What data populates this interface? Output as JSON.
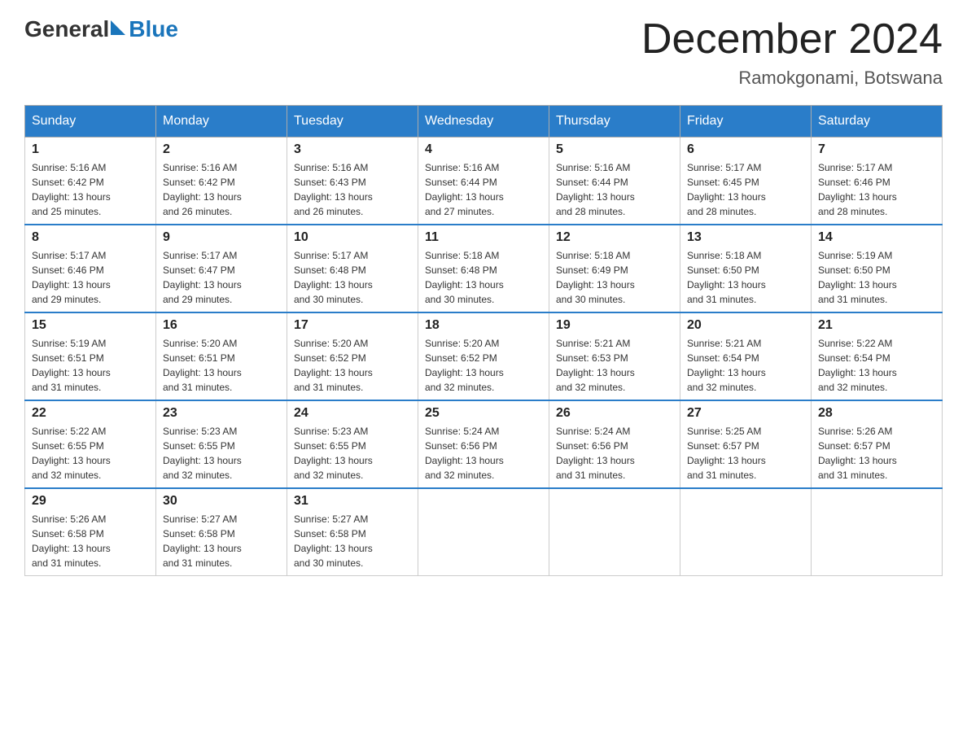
{
  "logo": {
    "general": "General",
    "blue": "Blue"
  },
  "title": {
    "month_year": "December 2024",
    "location": "Ramokgonami, Botswana"
  },
  "headers": [
    "Sunday",
    "Monday",
    "Tuesday",
    "Wednesday",
    "Thursday",
    "Friday",
    "Saturday"
  ],
  "weeks": [
    [
      {
        "day": "1",
        "sunrise": "5:16 AM",
        "sunset": "6:42 PM",
        "daylight": "13 hours and 25 minutes."
      },
      {
        "day": "2",
        "sunrise": "5:16 AM",
        "sunset": "6:42 PM",
        "daylight": "13 hours and 26 minutes."
      },
      {
        "day": "3",
        "sunrise": "5:16 AM",
        "sunset": "6:43 PM",
        "daylight": "13 hours and 26 minutes."
      },
      {
        "day": "4",
        "sunrise": "5:16 AM",
        "sunset": "6:44 PM",
        "daylight": "13 hours and 27 minutes."
      },
      {
        "day": "5",
        "sunrise": "5:16 AM",
        "sunset": "6:44 PM",
        "daylight": "13 hours and 28 minutes."
      },
      {
        "day": "6",
        "sunrise": "5:17 AM",
        "sunset": "6:45 PM",
        "daylight": "13 hours and 28 minutes."
      },
      {
        "day": "7",
        "sunrise": "5:17 AM",
        "sunset": "6:46 PM",
        "daylight": "13 hours and 28 minutes."
      }
    ],
    [
      {
        "day": "8",
        "sunrise": "5:17 AM",
        "sunset": "6:46 PM",
        "daylight": "13 hours and 29 minutes."
      },
      {
        "day": "9",
        "sunrise": "5:17 AM",
        "sunset": "6:47 PM",
        "daylight": "13 hours and 29 minutes."
      },
      {
        "day": "10",
        "sunrise": "5:17 AM",
        "sunset": "6:48 PM",
        "daylight": "13 hours and 30 minutes."
      },
      {
        "day": "11",
        "sunrise": "5:18 AM",
        "sunset": "6:48 PM",
        "daylight": "13 hours and 30 minutes."
      },
      {
        "day": "12",
        "sunrise": "5:18 AM",
        "sunset": "6:49 PM",
        "daylight": "13 hours and 30 minutes."
      },
      {
        "day": "13",
        "sunrise": "5:18 AM",
        "sunset": "6:50 PM",
        "daylight": "13 hours and 31 minutes."
      },
      {
        "day": "14",
        "sunrise": "5:19 AM",
        "sunset": "6:50 PM",
        "daylight": "13 hours and 31 minutes."
      }
    ],
    [
      {
        "day": "15",
        "sunrise": "5:19 AM",
        "sunset": "6:51 PM",
        "daylight": "13 hours and 31 minutes."
      },
      {
        "day": "16",
        "sunrise": "5:20 AM",
        "sunset": "6:51 PM",
        "daylight": "13 hours and 31 minutes."
      },
      {
        "day": "17",
        "sunrise": "5:20 AM",
        "sunset": "6:52 PM",
        "daylight": "13 hours and 31 minutes."
      },
      {
        "day": "18",
        "sunrise": "5:20 AM",
        "sunset": "6:52 PM",
        "daylight": "13 hours and 32 minutes."
      },
      {
        "day": "19",
        "sunrise": "5:21 AM",
        "sunset": "6:53 PM",
        "daylight": "13 hours and 32 minutes."
      },
      {
        "day": "20",
        "sunrise": "5:21 AM",
        "sunset": "6:54 PM",
        "daylight": "13 hours and 32 minutes."
      },
      {
        "day": "21",
        "sunrise": "5:22 AM",
        "sunset": "6:54 PM",
        "daylight": "13 hours and 32 minutes."
      }
    ],
    [
      {
        "day": "22",
        "sunrise": "5:22 AM",
        "sunset": "6:55 PM",
        "daylight": "13 hours and 32 minutes."
      },
      {
        "day": "23",
        "sunrise": "5:23 AM",
        "sunset": "6:55 PM",
        "daylight": "13 hours and 32 minutes."
      },
      {
        "day": "24",
        "sunrise": "5:23 AM",
        "sunset": "6:55 PM",
        "daylight": "13 hours and 32 minutes."
      },
      {
        "day": "25",
        "sunrise": "5:24 AM",
        "sunset": "6:56 PM",
        "daylight": "13 hours and 32 minutes."
      },
      {
        "day": "26",
        "sunrise": "5:24 AM",
        "sunset": "6:56 PM",
        "daylight": "13 hours and 31 minutes."
      },
      {
        "day": "27",
        "sunrise": "5:25 AM",
        "sunset": "6:57 PM",
        "daylight": "13 hours and 31 minutes."
      },
      {
        "day": "28",
        "sunrise": "5:26 AM",
        "sunset": "6:57 PM",
        "daylight": "13 hours and 31 minutes."
      }
    ],
    [
      {
        "day": "29",
        "sunrise": "5:26 AM",
        "sunset": "6:58 PM",
        "daylight": "13 hours and 31 minutes."
      },
      {
        "day": "30",
        "sunrise": "5:27 AM",
        "sunset": "6:58 PM",
        "daylight": "13 hours and 31 minutes."
      },
      {
        "day": "31",
        "sunrise": "5:27 AM",
        "sunset": "6:58 PM",
        "daylight": "13 hours and 30 minutes."
      },
      null,
      null,
      null,
      null
    ]
  ],
  "labels": {
    "sunrise": "Sunrise:",
    "sunset": "Sunset:",
    "daylight": "Daylight:"
  }
}
